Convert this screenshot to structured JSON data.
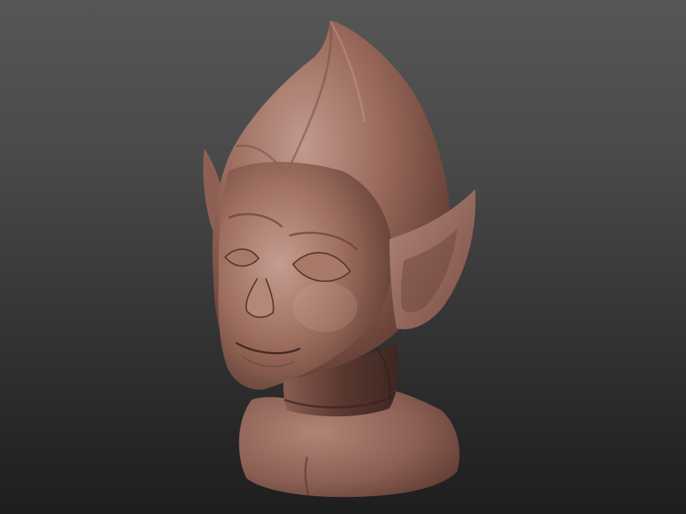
{
  "viewport": {
    "background_top": "#565656",
    "background_bottom": "#1e1e1e"
  },
  "subject": {
    "material_base": "#9a6a5c",
    "material_light": "#c29a8e",
    "material_shadow": "#4a2c26"
  }
}
